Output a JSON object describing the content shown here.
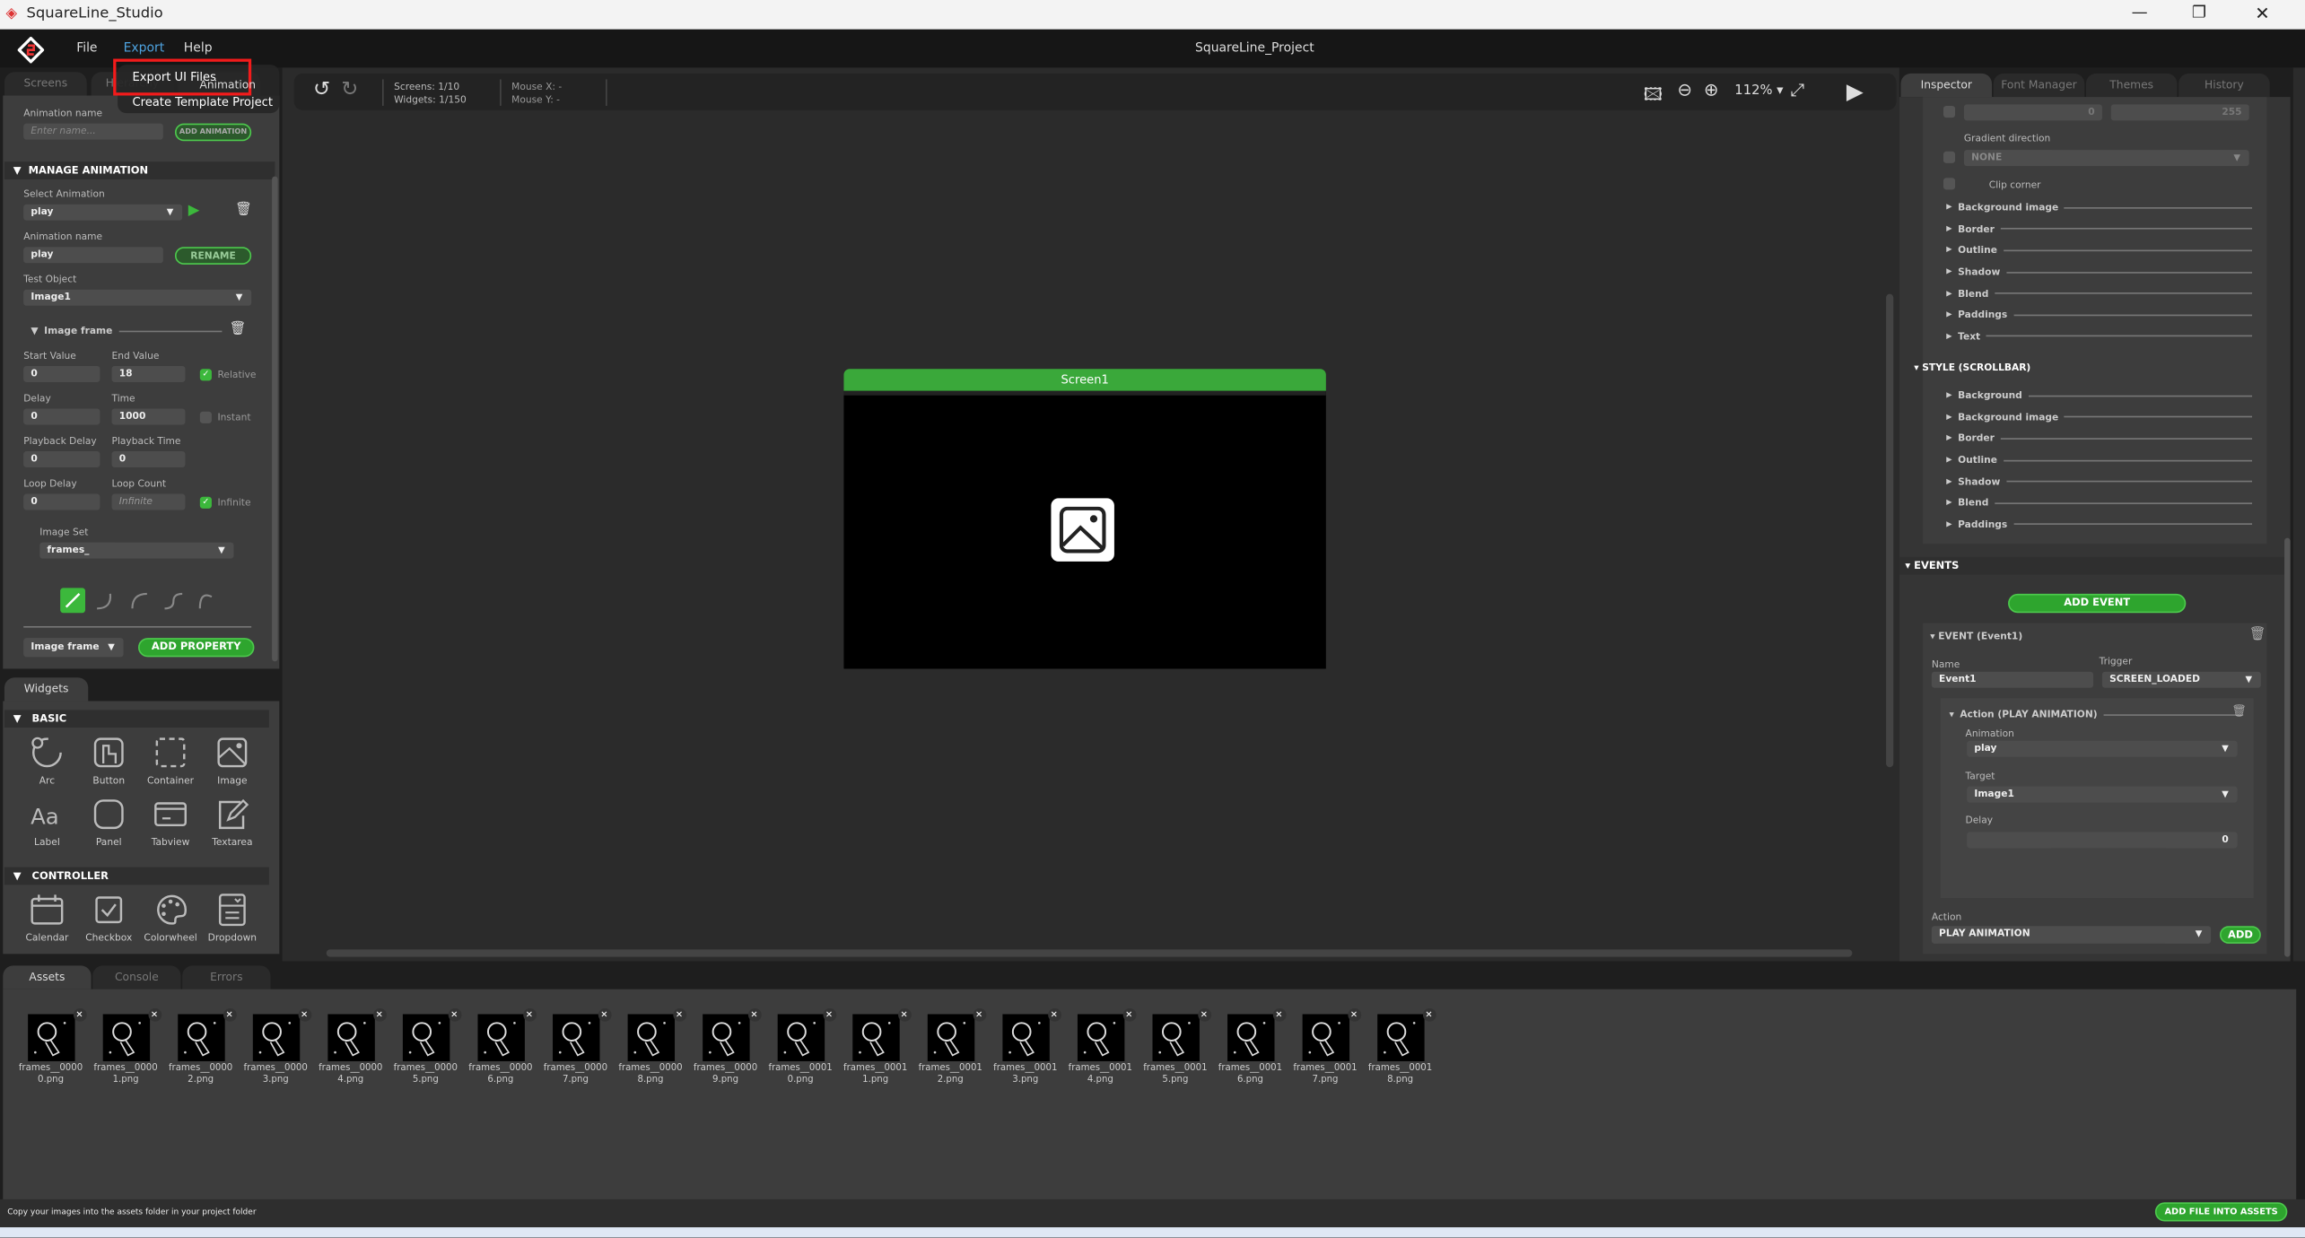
{
  "window": {
    "title": "SquareLine_Studio",
    "project": "SquareLine_Project"
  },
  "menu": {
    "items": [
      "File",
      "Export",
      "Help"
    ],
    "dropdown": [
      "Export UI Files",
      "Create Template Project"
    ]
  },
  "left_tabs": [
    "Screens",
    "Hierarchy",
    "Animation"
  ],
  "animation": {
    "name_label": "Animation name",
    "name_placeholder": "Enter name...",
    "add_label": "ADD ANIMATION",
    "manage_header": "MANAGE ANIMATION",
    "select_label": "Select Animation",
    "selected": "play",
    "rename_name_label": "Animation name",
    "rename_value": "play",
    "rename_label": "RENAME",
    "test_object_label": "Test Object",
    "test_object": "Image1",
    "property_header": "Image frame",
    "start_label": "Start Value",
    "start": "0",
    "end_label": "End Value",
    "end": "18",
    "relative_label": "Relative",
    "relative": true,
    "delay_label": "Delay",
    "delay": "0",
    "time_label": "Time",
    "time": "1000",
    "instant_label": "Instant",
    "instant": false,
    "pb_delay_label": "Playback Delay",
    "pb_delay": "0",
    "pb_time_label": "Playback Time",
    "pb_time": "0",
    "loop_delay_label": "Loop Delay",
    "loop_delay": "0",
    "loop_count_label": "Loop Count",
    "loop_count_placeholder": "Infinite",
    "infinite_label": "Infinite",
    "infinite": true,
    "image_set_label": "Image Set",
    "image_set": "frames_",
    "easing": [
      "linear",
      "ease-in",
      "ease-out",
      "ease-in-out",
      "overshoot"
    ],
    "property_select": "Image frame",
    "add_property": "ADD PROPERTY"
  },
  "widgets": {
    "tab": "Widgets",
    "sections": [
      {
        "title": "BASIC",
        "items": [
          {
            "label": "Arc",
            "icon": "arc-icon"
          },
          {
            "label": "Button",
            "icon": "button-icon"
          },
          {
            "label": "Container",
            "icon": "container-icon"
          },
          {
            "label": "Image",
            "icon": "image-icon"
          },
          {
            "label": "Label",
            "icon": "label-icon"
          },
          {
            "label": "Panel",
            "icon": "panel-icon"
          },
          {
            "label": "Tabview",
            "icon": "tabview-icon"
          },
          {
            "label": "Textarea",
            "icon": "textarea-icon"
          }
        ]
      },
      {
        "title": "CONTROLLER",
        "items": [
          {
            "label": "Calendar",
            "icon": "calendar-icon"
          },
          {
            "label": "Checkbox",
            "icon": "checkbox-icon"
          },
          {
            "label": "Colorwheel",
            "icon": "colorwheel-icon"
          },
          {
            "label": "Dropdown",
            "icon": "dropdown-icon"
          }
        ]
      }
    ]
  },
  "toolbar": {
    "screens": "Screens: 1/10",
    "widgets": "Widgets: 1/150",
    "mouse_x": "Mouse X: -",
    "mouse_y": "Mouse Y: -",
    "zoom": "112%"
  },
  "canvas": {
    "screen_name": "Screen1"
  },
  "inspector": {
    "tabs": [
      "Inspector",
      "Font Manager",
      "Themes",
      "History"
    ],
    "grad_values": [
      "0",
      "255"
    ],
    "gradient_label": "Gradient direction",
    "gradient": "NONE",
    "clip_corner": "Clip corner",
    "style_rows": [
      "Background image",
      "Border",
      "Outline",
      "Shadow",
      "Blend",
      "Paddings",
      "Text"
    ],
    "scrollbar_header": "STYLE (SCROLLBAR)",
    "scrollbar_rows": [
      "Background",
      "Background image",
      "Border",
      "Outline",
      "Shadow",
      "Blend",
      "Paddings"
    ],
    "events_header": "EVENTS",
    "add_event": "ADD EVENT",
    "event_header": "EVENT (Event1)",
    "name_label": "Name",
    "name": "Event1",
    "trigger_label": "Trigger",
    "trigger": "SCREEN_LOADED",
    "action_header": "Action (PLAY ANIMATION)",
    "anim_label": "Animation",
    "anim": "play",
    "target_label": "Target",
    "target": "Image1",
    "delay_label": "Delay",
    "delay": "0",
    "action_label": "Action",
    "action": "PLAY ANIMATION",
    "add": "ADD"
  },
  "bottom": {
    "tabs": [
      "Assets",
      "Console",
      "Errors"
    ],
    "assets": [
      "frames__00000.png",
      "frames__00001.png",
      "frames__00002.png",
      "frames__00003.png",
      "frames__00004.png",
      "frames__00005.png",
      "frames__00006.png",
      "frames__00007.png",
      "frames__00008.png",
      "frames__00009.png",
      "frames__00010.png",
      "frames__00011.png",
      "frames__00012.png",
      "frames__00013.png",
      "frames__00014.png",
      "frames__00015.png",
      "frames__00016.png",
      "frames__00017.png",
      "frames__00018.png"
    ],
    "hint": "Copy your images into the assets folder in your project folder",
    "add_file": "ADD FILE INTO ASSETS"
  },
  "colors": {
    "accent": "#2ea52e",
    "menu_active": "#4ea3e0",
    "highlight": "#e02020"
  }
}
